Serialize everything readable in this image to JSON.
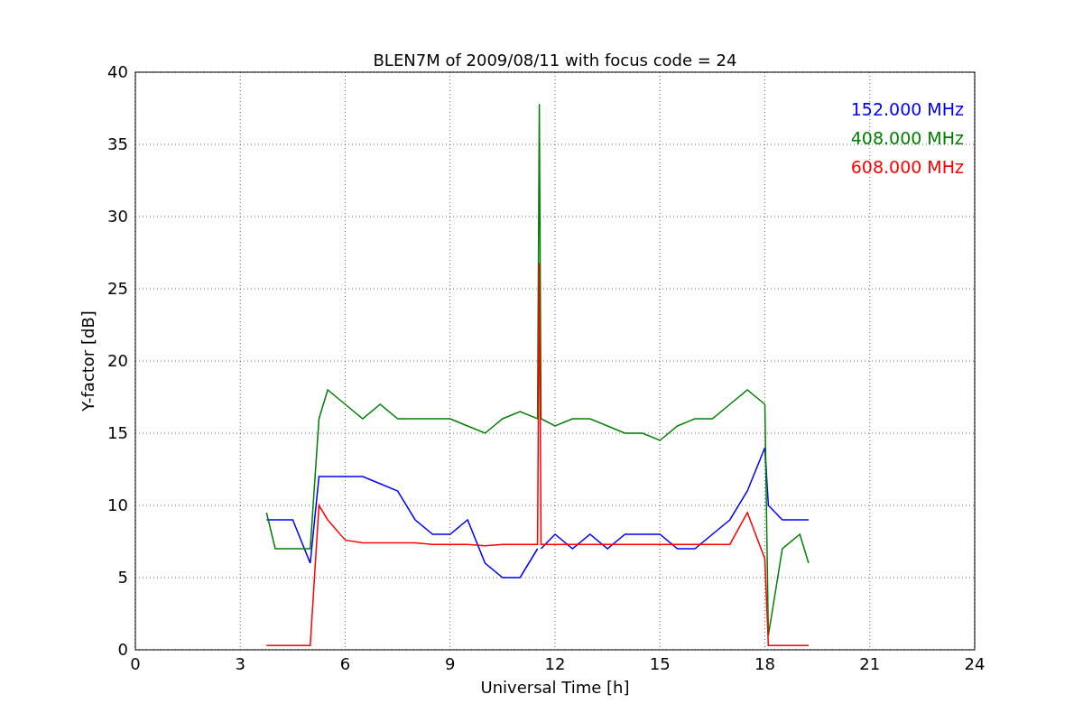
{
  "figure": {
    "chart_data": {
      "type": "line",
      "title": "BLEN7M of 2009/08/11 with focus code = 24",
      "xlabel": "Universal Time [h]",
      "ylabel": "Y-factor [dB]",
      "xlim": [
        0,
        24
      ],
      "ylim": [
        0,
        40
      ],
      "xticks": [
        0,
        3,
        6,
        9,
        12,
        15,
        18,
        21,
        24
      ],
      "yticks": [
        0,
        5,
        10,
        15,
        20,
        25,
        30,
        35,
        40
      ],
      "grid": true,
      "x": [
        3.75,
        4,
        4.5,
        5,
        5.25,
        5.5,
        6,
        6.5,
        7,
        7.5,
        8,
        8.5,
        9,
        9.5,
        10,
        10.5,
        11,
        11.5,
        11.55,
        11.6,
        12,
        12.5,
        13,
        13.5,
        14,
        14.5,
        15,
        15.5,
        16,
        16.5,
        17,
        17.5,
        18,
        18.1,
        18.5,
        19,
        19.25
      ],
      "series": [
        {
          "name": "152.000 MHz",
          "color": "#0000ff",
          "values": [
            9,
            9,
            9,
            6,
            12,
            12,
            12,
            12,
            11.5,
            11,
            9,
            8,
            8,
            9,
            6,
            5,
            5,
            7,
            null,
            7,
            8,
            7,
            8,
            7,
            8,
            8,
            8,
            7,
            7,
            8,
            9,
            11,
            14,
            10,
            9,
            9,
            9
          ]
        },
        {
          "name": "408.000 MHz",
          "color": "#008000",
          "values": [
            9.5,
            7,
            7,
            7,
            16,
            18,
            17,
            16,
            17,
            16,
            16,
            16,
            16,
            15.5,
            15,
            16,
            16.5,
            16,
            37.8,
            16,
            15.5,
            16,
            16,
            15.5,
            15,
            15,
            14.5,
            15.5,
            16,
            16,
            17,
            18,
            17,
            1,
            7,
            8,
            6
          ]
        },
        {
          "name": "608.000 MHz",
          "color": "#ff0000",
          "values": [
            0.3,
            0.3,
            0.3,
            0.3,
            10,
            9,
            7.6,
            7.4,
            7.4,
            7.4,
            7.4,
            7.3,
            7.3,
            7.3,
            7.2,
            7.3,
            7.3,
            7.3,
            26.8,
            7.3,
            7.3,
            7.3,
            7.3,
            7.3,
            7.3,
            7.3,
            7.3,
            7.3,
            7.3,
            7.3,
            7.3,
            9.5,
            6.3,
            0.3,
            0.3,
            0.3,
            0.3
          ]
        }
      ]
    }
  }
}
